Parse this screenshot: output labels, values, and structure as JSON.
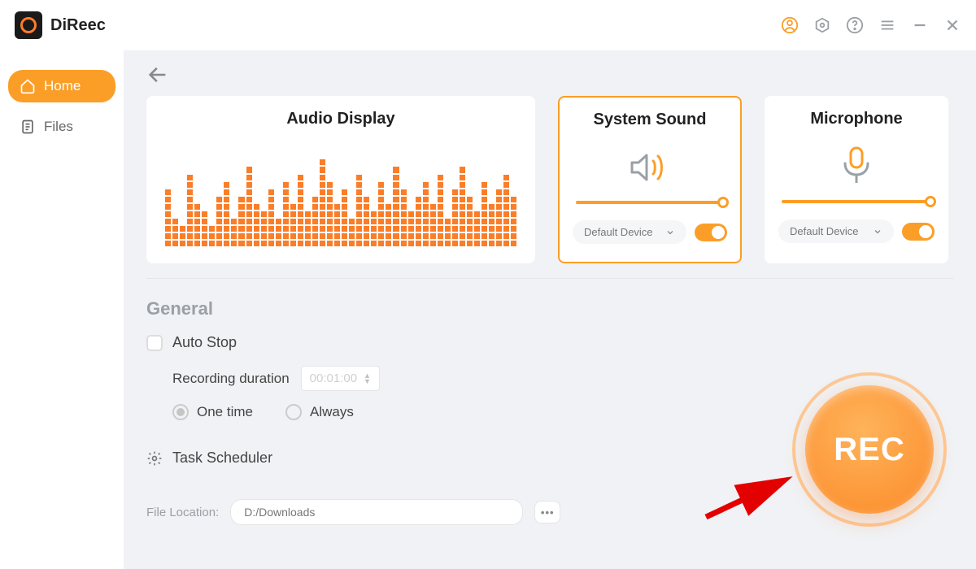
{
  "app": {
    "name": "DiReec"
  },
  "sidebar": {
    "home": "Home",
    "files": "Files"
  },
  "cards": {
    "audio_display": "Audio Display",
    "system_sound": "System Sound",
    "microphone": "Microphone",
    "device_default": "Default Device"
  },
  "general": {
    "title": "General",
    "auto_stop": "Auto Stop",
    "recording_duration_label": "Recording duration",
    "recording_duration_value": "00:01:00",
    "one_time": "One time",
    "always": "Always",
    "task_scheduler": "Task Scheduler"
  },
  "file": {
    "label": "File Location:",
    "path": "D:/Downloads"
  },
  "rec": {
    "label": "REC"
  },
  "equalizer_heights": [
    8,
    4,
    3,
    10,
    6,
    5,
    3,
    7,
    9,
    4,
    7,
    11,
    6,
    5,
    8,
    4,
    9,
    6,
    10,
    5,
    7,
    12,
    9,
    6,
    8,
    4,
    10,
    7,
    5,
    9,
    6,
    11,
    8,
    5,
    7,
    9,
    6,
    10,
    4,
    8,
    11,
    7,
    5,
    9,
    6,
    8,
    10,
    7
  ]
}
